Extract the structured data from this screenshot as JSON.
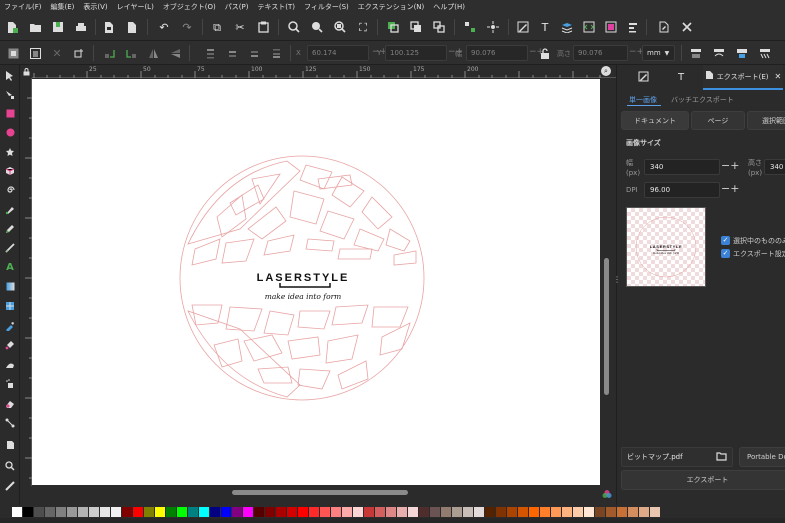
{
  "menu": [
    "ファイル(F)",
    "編集(E)",
    "表示(V)",
    "レイヤー(L)",
    "オブジェクト(O)",
    "パス(P)",
    "テキスト(T)",
    "フィルター(S)",
    "エクステンション(N)",
    "ヘルプ(H)"
  ],
  "controls": {
    "x_label": "X",
    "x_value": "60.174",
    "y_label": "Y",
    "y_value": "100.125",
    "w_label": "幅",
    "w_value": "90.076",
    "h_label": "高さ",
    "h_value": "90.076",
    "unit": "mm"
  },
  "ruler": {
    "ticks": [
      "25",
      "50",
      "75",
      "100",
      "125",
      "150",
      "175",
      "200"
    ]
  },
  "logo": {
    "brand": "LASERSTYLE",
    "tagline": "make idea into form"
  },
  "panel": {
    "tab_export": "エクスポート(E)",
    "subtab_single": "単一画像",
    "subtab_batch": "バッチエクスポート",
    "area_document": "ドキュメント",
    "area_page": "ページ",
    "area_selection": "選択範囲",
    "image_size_title": "画像サイズ",
    "width_label": "幅",
    "width_unit": "(px)",
    "width_value": "340",
    "height_label": "高さ",
    "height_unit": "(px)",
    "height_value": "340",
    "dpi_label": "DPI",
    "dpi_value": "96.00",
    "check_selected_only": "選択中のもののみ",
    "check_export_settings": "エクスポート設定を",
    "filename": "ビットマップ.pdf",
    "format": "Portable Document",
    "export_button": "エクスポート",
    "preview_brand": "LASERSTYLE",
    "preview_tagline": "make idea into form"
  },
  "palette": [
    "#ffffff",
    "#000000",
    "#4d4d4d",
    "#666666",
    "#808080",
    "#999999",
    "#b3b3b3",
    "#cccccc",
    "#e6e6e6",
    "#f2f2f2",
    "#800000",
    "#ff0000",
    "#808000",
    "#ffff00",
    "#008000",
    "#00ff00",
    "#008080",
    "#00ffff",
    "#000080",
    "#0000ff",
    "#800080",
    "#ff00ff",
    "#550000",
    "#800000",
    "#aa0000",
    "#d40000",
    "#ff0000",
    "#ff2a2a",
    "#ff5555",
    "#ff8080",
    "#ffaaaa",
    "#ffd5d5",
    "#c83737",
    "#d35f5f",
    "#de8787",
    "#e9afaf",
    "#f4d7d7",
    "#502d2d",
    "#6c5353",
    "#917c6f",
    "#ac9d93",
    "#c8beb7",
    "#e3dbdb",
    "#552200",
    "#803300",
    "#aa4400",
    "#d45500",
    "#ff6600",
    "#ff7f2a",
    "#ff9955",
    "#ffb380",
    "#ffccaa",
    "#ffe6d5",
    "#784421",
    "#a05a2c",
    "#c87137",
    "#d38d5f",
    "#deaa87",
    "#e9c6af"
  ]
}
